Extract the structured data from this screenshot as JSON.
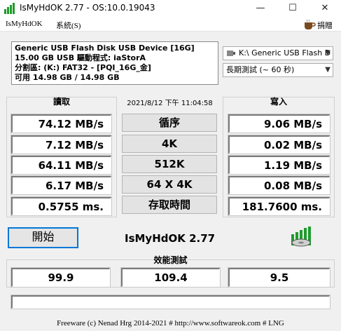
{
  "window": {
    "title": "IsMyHdOK 2.77 - OS:10.0.19043",
    "minimize": "—",
    "maximize": "☐",
    "close": "✕"
  },
  "menu": {
    "items": [
      "IsMyHdOK",
      "系統(S)"
    ],
    "donate": "捐贈",
    "donate_icon": "coffee-cup-icon"
  },
  "device": {
    "line1": "Generic USB Flash Disk USB Device [16G]",
    "line2": "15.00 GB  USB 驅動程式: iaStorA",
    "line3": "分割區: (K:) FAT32 - [PQI_16G_金]",
    "line4": "可用 14.98 GB / 14.98 GB"
  },
  "drive_select": {
    "value": "K:\\ Generic USB Flash D",
    "icon": "drive-icon"
  },
  "test_select": {
    "value": "長期測試 (~ 60 秒)"
  },
  "read": {
    "header": "讀取",
    "values": [
      "74.12 MB/s",
      "7.12 MB/s",
      "64.11 MB/s",
      "6.17 MB/s",
      "0.5755 ms."
    ]
  },
  "write": {
    "header": "寫入",
    "values": [
      "9.06 MB/s",
      "0.02 MB/s",
      "1.19 MB/s",
      "0.08 MB/s",
      "181.7600 ms."
    ]
  },
  "middle": {
    "timestamp": "2021/8/12 下午 11:04:58",
    "buttons": [
      "循序",
      "4K",
      "512K",
      "64 X 4K",
      "存取時間"
    ]
  },
  "start_button": "開始",
  "app_name": "IsMyHdOK 2.77",
  "logo_icon": "hdd-bars-logo-icon",
  "performance": {
    "header": "效能測試",
    "values": [
      "99.9",
      "109.4",
      "9.5"
    ]
  },
  "footer": "Freeware (c) Nenad Hrg 2014-2021 # http://www.softwareok.com     # LNG",
  "colors": {
    "accent": "#0078d7",
    "logo_green": "#1e9c2c"
  }
}
